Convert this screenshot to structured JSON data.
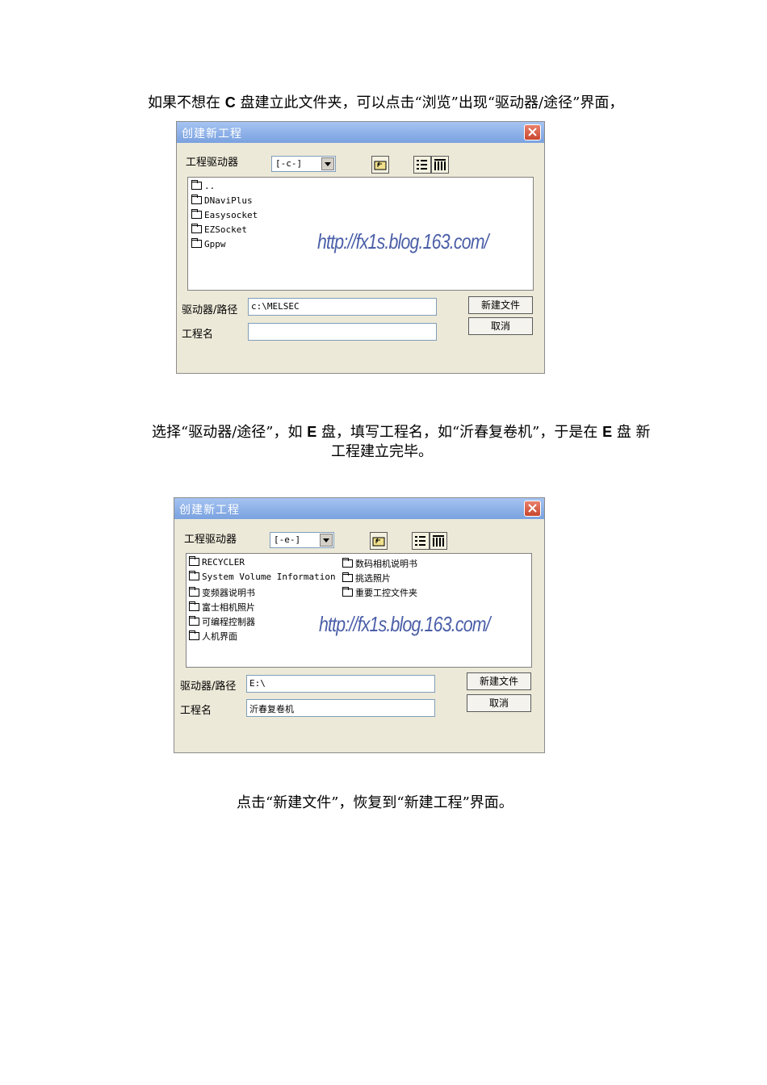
{
  "paragraph1": {
    "before": "如果不想在 ",
    "letter": "C",
    "after": " 盘建立此文件夹，可以点击“浏览”出现“驱动器/途径”界面，"
  },
  "dialog1": {
    "title": "创建新工程",
    "drive_label": "工程驱动器",
    "drive_value": "[-c-]",
    "files": [
      "..",
      "DNaviPlus",
      "Easysocket",
      "EZSocket",
      "Gppw"
    ],
    "watermark": "http://fx1s.blog.163.com/",
    "path_label": "驱动器/路径",
    "path_value": "c:\\MELSEC",
    "name_label": "工程名",
    "name_value": "",
    "new_button": "新建文件",
    "cancel_button": "取消"
  },
  "paragraph2": {
    "part1": "选择“驱动器/途径”，如 ",
    "letter1": "E",
    "part2": " 盘，填写工程名，如“沂春复卷机”，于是在 ",
    "letter2": "E",
    "part3": " 盘 新",
    "line2": "工程建立完毕。"
  },
  "dialog2": {
    "title": "创建新工程",
    "drive_label": "工程驱动器",
    "drive_value": "[-e-]",
    "files_col1": [
      "RECYCLER",
      "System Volume Information",
      "变频器说明书",
      "富士相机照片",
      "可编程控制器",
      "人机界面"
    ],
    "files_col2": [
      "数码相机说明书",
      "挑选照片",
      "重要工控文件夹"
    ],
    "watermark": "http://fx1s.blog.163.com/",
    "path_label": "驱动器/路径",
    "path_value": "E:\\",
    "name_label": "工程名",
    "name_value": "沂春复卷机",
    "new_button": "新建文件",
    "cancel_button": "取消"
  },
  "paragraph3": "点击“新建文件”，恢复到“新建工程”界面。"
}
